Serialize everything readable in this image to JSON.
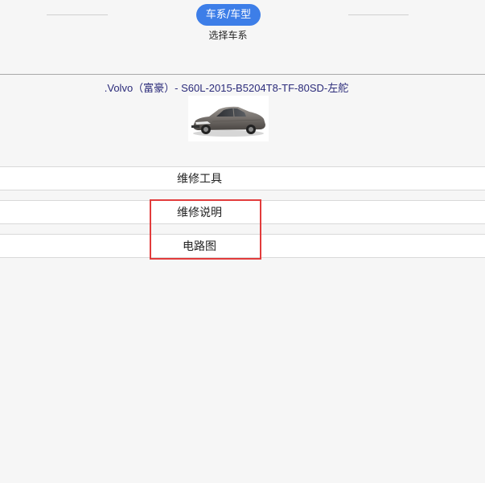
{
  "stepper": {
    "active_step": "车系/车型",
    "caption": "选择车系"
  },
  "vehicle": {
    "title": ".Volvo（富豪）- S60L-2015-B5204T8-TF-80SD-左舵",
    "image": "car-photo"
  },
  "menu": {
    "items": [
      {
        "label": "维修工具"
      },
      {
        "label": "维修说明"
      },
      {
        "label": "电路图"
      }
    ]
  },
  "colors": {
    "accent": "#3d7ee8",
    "highlight": "#e23c3c",
    "background": "#f6f6f6"
  }
}
